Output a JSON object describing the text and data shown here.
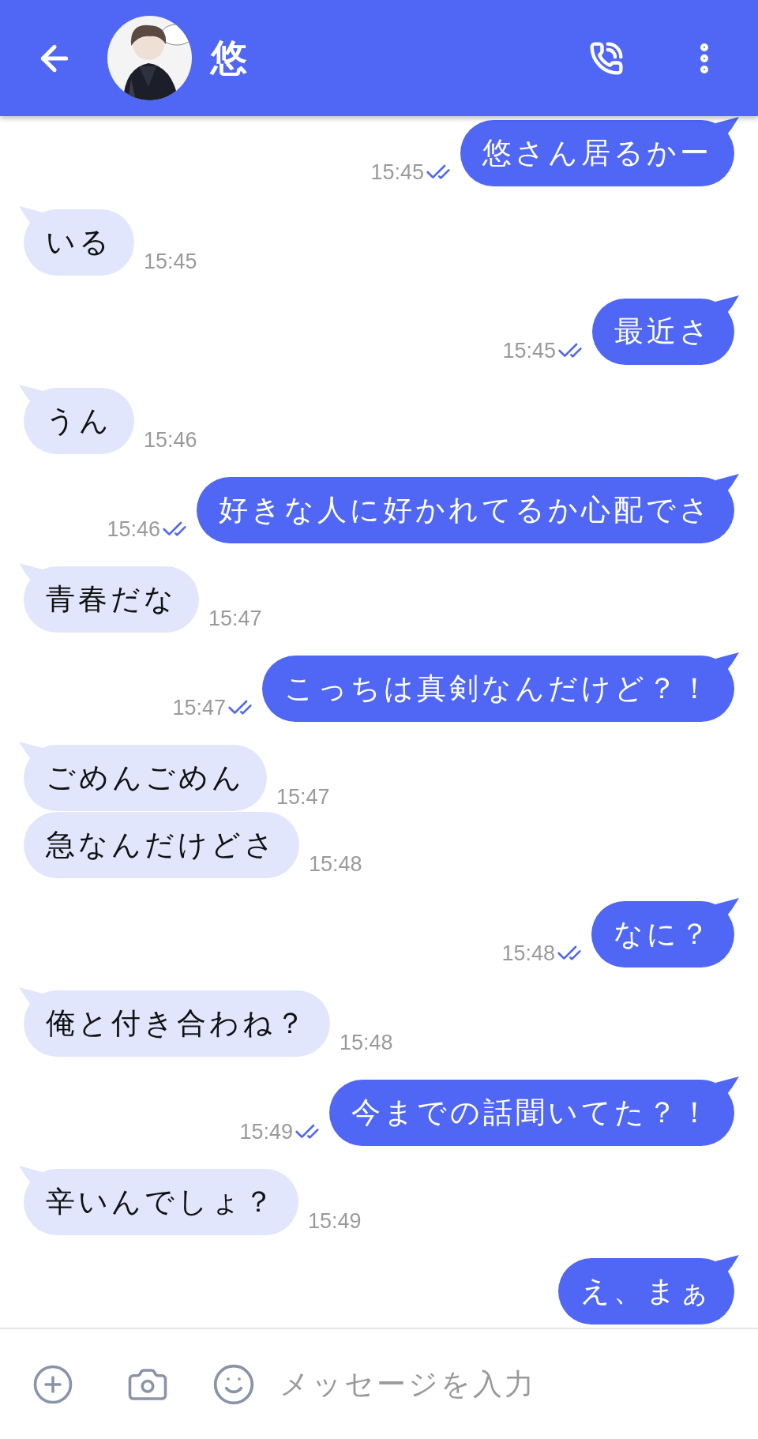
{
  "header": {
    "title": "悠"
  },
  "messages": [
    {
      "kind": "sent",
      "text": "悠さん居るかー",
      "time": "15:45",
      "read": true
    },
    {
      "kind": "received",
      "text": "いる",
      "time": "15:45"
    },
    {
      "kind": "sent",
      "text": "最近さ",
      "time": "15:45",
      "read": true
    },
    {
      "kind": "received",
      "text": "うん",
      "time": "15:46"
    },
    {
      "kind": "sent",
      "text": "好きな人に好かれてるか心配でさ",
      "time": "15:46",
      "read": true
    },
    {
      "kind": "received",
      "text": "青春だな",
      "time": "15:47"
    },
    {
      "kind": "sent",
      "text": "こっちは真剣なんだけど？！",
      "time": "15:47",
      "read": true
    },
    {
      "kind": "received",
      "text": "ごめんごめん",
      "time": "15:47"
    },
    {
      "kind": "received",
      "text": "急なんだけどさ",
      "time": "15:48"
    },
    {
      "kind": "sent",
      "text": "なに？",
      "time": "15:48",
      "read": true
    },
    {
      "kind": "received",
      "text": "俺と付き合わね？",
      "time": "15:48"
    },
    {
      "kind": "sent",
      "text": "今までの話聞いてた？！",
      "time": "15:49",
      "read": true
    },
    {
      "kind": "received",
      "text": "辛いんでしょ？",
      "time": "15:49"
    },
    {
      "kind": "sent",
      "text": "え、まぁ"
    }
  ],
  "input": {
    "placeholder": "メッセージを入力"
  }
}
